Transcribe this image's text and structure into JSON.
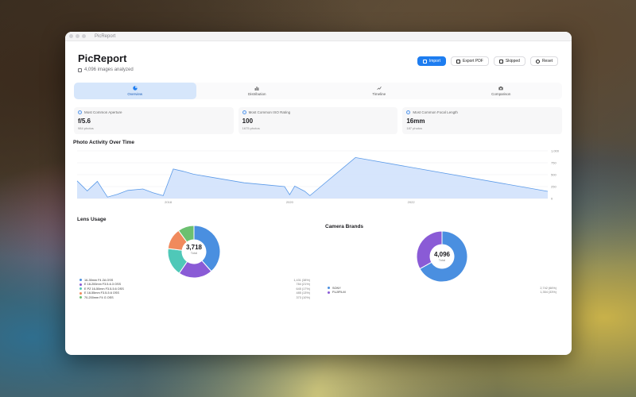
{
  "window": {
    "title": "PicReport"
  },
  "header": {
    "title": "PicReport",
    "subtitle": "4,096 images analyzed"
  },
  "toolbar": {
    "import_label": "Import",
    "export_label": "Export PDF",
    "skipped_label": "Skipped",
    "reset_label": "Reset"
  },
  "tabs": [
    {
      "label": "Overview",
      "active": true
    },
    {
      "label": "Distribution",
      "active": false
    },
    {
      "label": "Timeline",
      "active": false
    },
    {
      "label": "Comparison",
      "active": false
    }
  ],
  "stats": [
    {
      "label": "Most Common Aperture",
      "value": "f/5.6",
      "sub": "984 photos"
    },
    {
      "label": "Most Common ISO Rating",
      "value": "100",
      "sub": "1675 photos"
    },
    {
      "label": "Most Common Focal Length",
      "value": "16mm",
      "sub": "187 photos"
    }
  ],
  "activity": {
    "title": "Photo Activity Over Time",
    "y_ticks": [
      "1,000",
      "750",
      "500",
      "250",
      "0"
    ],
    "x_ticks": [
      "2018",
      "2020",
      "2022"
    ]
  },
  "lens": {
    "title": "Lens Usage",
    "total": "3,718",
    "total_label": "Total",
    "items": [
      {
        "name": "16-35mm F4 ZA OSS",
        "value": "1,431 (38%)",
        "color": "#4a8fe0"
      },
      {
        "name": "E 18-200mm F3.5-6.3 OSS",
        "value": "784 (21%)",
        "color": "#8a5bd6"
      },
      {
        "name": "E PZ 16-50mm F3.5-5.6 OSS",
        "value": "645 (17%)",
        "color": "#4fc8b8"
      },
      {
        "name": "E 18-55mm F3.5-5.6 OSS",
        "value": "485 (13%)",
        "color": "#f08a5d"
      },
      {
        "name": "70-200mm F4 G OSS",
        "value": "373 (10%)",
        "color": "#6cc070"
      }
    ]
  },
  "brands": {
    "title": "Camera Brands",
    "total": "4,096",
    "total_label": "Total",
    "items": [
      {
        "name": "SONY",
        "value": "2,742 (66%)",
        "color": "#4a8fe0"
      },
      {
        "name": "FUJIFILM",
        "value": "1,354 (33%)",
        "color": "#8a5bd6"
      }
    ]
  },
  "chart_data": [
    {
      "type": "area",
      "title": "Photo Activity Over Time",
      "xlabel": "",
      "ylabel": "",
      "ylim": [
        0,
        1000
      ],
      "xlim": [
        "2016-07",
        "2024-04"
      ],
      "grid": true,
      "x": [
        "2016-07",
        "2016-09",
        "2016-11",
        "2017-01",
        "2017-03",
        "2017-05",
        "2017-08",
        "2017-10",
        "2017-12",
        "2018-02",
        "2018-04",
        "2018-06",
        "2019-04",
        "2019-09",
        "2019-12",
        "2020-01",
        "2020-02",
        "2020-04",
        "2020-05",
        "2021-02",
        "2024-04"
      ],
      "values": [
        370,
        160,
        360,
        30,
        90,
        170,
        200,
        120,
        60,
        620,
        570,
        510,
        330,
        280,
        250,
        80,
        260,
        150,
        60,
        860,
        150
      ]
    },
    {
      "type": "pie",
      "title": "Lens Usage",
      "categories": [
        "16-35mm F4 ZA OSS",
        "E 18-200mm F3.5-6.3 OSS",
        "E PZ 16-50mm F3.5-5.6 OSS",
        "E 18-55mm F3.5-5.6 OSS",
        "70-200mm F4 G OSS"
      ],
      "values": [
        1431,
        784,
        645,
        485,
        373
      ]
    },
    {
      "type": "pie",
      "title": "Camera Brands",
      "categories": [
        "SONY",
        "FUJIFILM"
      ],
      "values": [
        2742,
        1354
      ]
    }
  ]
}
